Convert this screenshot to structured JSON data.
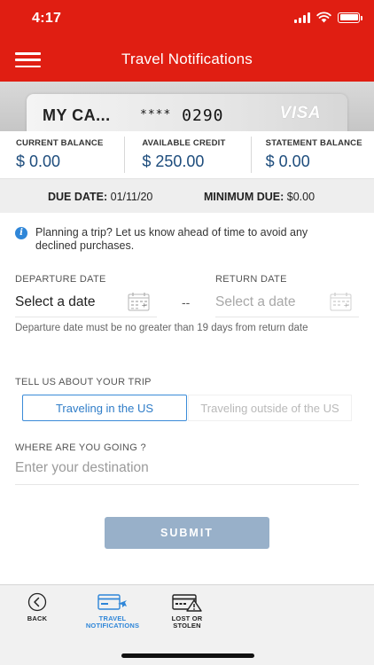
{
  "status_bar": {
    "time": "4:17"
  },
  "header": {
    "title": "Travel Notifications"
  },
  "card": {
    "name": "MY CA...",
    "masked": "****",
    "last4": "0290",
    "brand": "VISA"
  },
  "balances": [
    {
      "label": "CURRENT BALANCE",
      "value": "$ 0.00"
    },
    {
      "label": "AVAILABLE CREDIT",
      "value": "$ 250.00"
    },
    {
      "label": "STATEMENT BALANCE",
      "value": "$ 0.00"
    }
  ],
  "due": {
    "due_date_label": "DUE DATE:",
    "due_date": "01/11/20",
    "min_due_label": "MINIMUM DUE:",
    "min_due": "$0.00"
  },
  "form": {
    "info": "Planning a trip? Let us know ahead of time to avoid any declined purchases.",
    "departure_label": "DEPARTURE DATE",
    "departure_value": "Select a date",
    "return_label": "RETURN DATE",
    "return_value": "Select a date",
    "separator": "--",
    "hint": "Departure date must be no greater than 19 days from return date",
    "trip_label": "TELL US ABOUT YOUR TRIP",
    "trip_options": [
      "Traveling in the US",
      "Traveling outside of the US"
    ],
    "selected_trip": "Traveling in the US",
    "destination_label": "WHERE ARE YOU GOING ?",
    "destination_placeholder": "Enter your destination",
    "submit": "SUBMIT"
  },
  "bottom_nav": [
    {
      "label": "BACK",
      "icon": "back-arrow-icon",
      "active": false
    },
    {
      "label_line1": "TRAVEL",
      "label_line2": "NOTIFICATIONS",
      "icon": "travel-card-icon",
      "active": true
    },
    {
      "label_line1": "LOST OR",
      "label_line2": "STOLEN",
      "icon": "lost-card-warning-icon",
      "active": false
    }
  ],
  "colors": {
    "header": "#e01e12",
    "accent": "#2f86d8",
    "submit_disabled": "#98b0c9",
    "balance_value": "#1d4c7c"
  }
}
